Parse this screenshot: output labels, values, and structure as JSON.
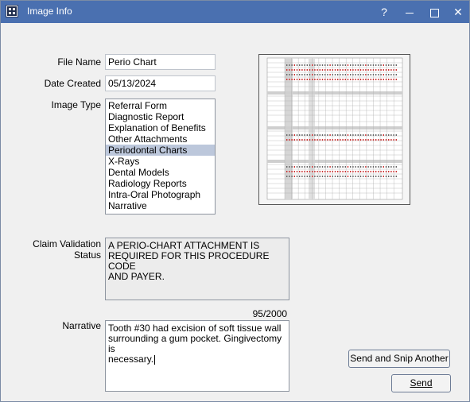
{
  "window": {
    "title": "Image Info",
    "buttons": {
      "help": "?",
      "maximize": "☐",
      "close": "✕"
    }
  },
  "form": {
    "file_name_label": "File Name",
    "file_name_value": "Perio Chart",
    "date_created_label": "Date Created",
    "date_created_value": "05/13/2024",
    "image_type_label": "Image Type",
    "image_types": [
      "Referral Form",
      "Diagnostic Report",
      "Explanation of Benefits",
      "Other Attachments",
      "Periodontal Charts",
      "X-Rays",
      "Dental Models",
      "Radiology Reports",
      "Intra-Oral Photograph",
      "Narrative"
    ],
    "selected_image_type": "Periodontal Charts",
    "claim_validation_label": "Claim Validation Status",
    "claim_validation_lines": [
      "A PERIO-CHART ATTACHMENT IS",
      "REQUIRED FOR THIS PROCEDURE CODE",
      "AND PAYER."
    ],
    "narrative_label": "Narrative",
    "narrative_counter": "95/2000",
    "narrative_lines": [
      "Tooth #30 had excision of soft tissue wall",
      "surrounding a gum pocket. Gingivectomy is",
      "necessary."
    ]
  },
  "buttons": {
    "send_and_snip": "Send and Snip Another",
    "send": "Send"
  },
  "preview": {
    "icon": "perio-chart-thumbnail",
    "upper_teeth": [
      "1",
      "2",
      "3",
      "4",
      "5",
      "6",
      "7",
      "8",
      "9",
      "10",
      "11",
      "12",
      "13",
      "14",
      "15",
      "16"
    ],
    "lower_teeth": [
      "32",
      "31",
      "30",
      "29",
      "28",
      "27",
      "26",
      "25",
      "24",
      "23",
      "22",
      "21",
      "20",
      "19",
      "18",
      "17"
    ]
  }
}
